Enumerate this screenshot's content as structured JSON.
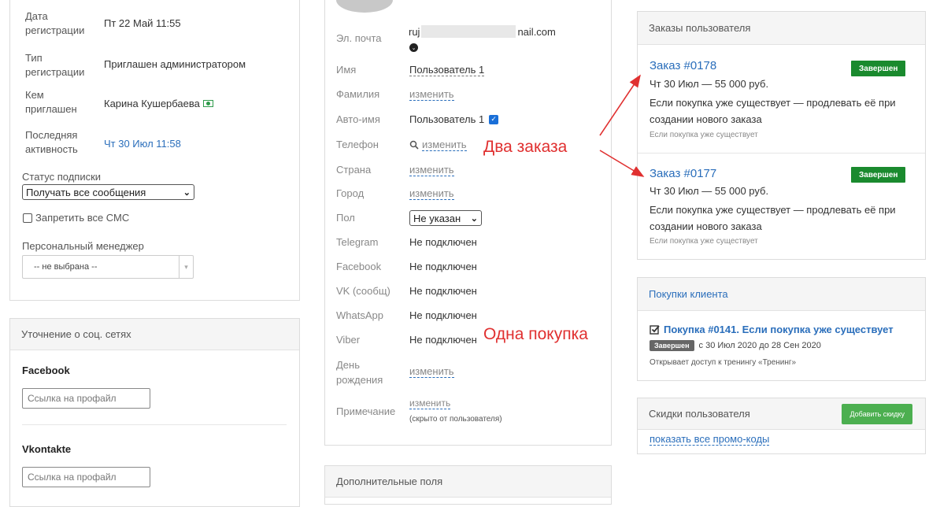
{
  "left": {
    "reg_date_label": "Дата регистрации",
    "reg_date_value": "Пт 22 Май 11:55",
    "reg_type_label": "Тип регистрации",
    "reg_type_value": "Приглашен администратором",
    "invited_by_label": "Кем приглашен",
    "invited_by_value": "Карина Кушербаева",
    "last_activity_label": "Последняя активность",
    "last_activity_value": "Чт 30 Июл 11:58",
    "subscription_label": "Статус подписки",
    "subscription_value": "Получать все сообщения",
    "block_sms_label": "Запретить все СМС",
    "manager_label": "Персональный менеджер",
    "manager_value": "-- не выбрана --"
  },
  "social": {
    "header": "Уточнение о соц. сетях",
    "facebook_title": "Facebook",
    "facebook_placeholder": "Ссылка на профайл",
    "vk_title": "Vkontakte",
    "vk_placeholder": "Ссылка на профайл"
  },
  "profile": {
    "email_label": "Эл. почта",
    "email_start": "ruj",
    "email_end": "nail.com",
    "name_label": "Имя",
    "name_value": "Пользователь 1",
    "surname_label": "Фамилия",
    "change": "изменить",
    "autoname_label": "Авто-имя",
    "autoname_value": "Пользователь 1",
    "phone_label": "Телефон",
    "country_label": "Страна",
    "city_label": "Город",
    "gender_label": "Пол",
    "gender_value": "Не указан",
    "telegram_label": "Telegram",
    "facebook_label": "Facebook",
    "vk_label": "VK (сообщ)",
    "whatsapp_label": "WhatsApp",
    "viber_label": "Viber",
    "not_connected": "Не подключен",
    "birthday_label": "День рождения",
    "note_label": "Примечание",
    "note_hidden": "(скрыто от пользователя)"
  },
  "extra": {
    "header": "Дополнительные поля"
  },
  "orders": {
    "header": "Заказы пользователя",
    "items": [
      {
        "title": "Заказ #0178",
        "status": "Завершен",
        "meta": "Чт 30 Июл — 55 000 руб.",
        "desc": "Если покупка уже существует — продлевать её при создании нового заказа",
        "small": "Если покупка уже существует"
      },
      {
        "title": "Заказ #0177",
        "status": "Завершен",
        "meta": "Чт 30 Июл — 55 000 руб.",
        "desc": "Если покупка уже существует — продлевать её при создании нового заказа",
        "small": "Если покупка уже существует"
      }
    ]
  },
  "purchases": {
    "header": "Покупки клиента",
    "title": "Покупка #0141. Если покупка уже существует",
    "status": "Завершен",
    "dates": "с 30 Июл 2020 до 28 Сен 2020",
    "access": "Открывает доступ к тренингу «Тренинг»"
  },
  "discounts": {
    "header": "Скидки пользователя",
    "add_button": "Добавить скидку",
    "show_promo": "показать все промо-коды"
  },
  "annotations": {
    "two_orders": "Два заказа",
    "one_purchase": "Одна покупка"
  },
  "colors": {
    "link": "#2a6ebb",
    "success": "#1a8a2e",
    "add_button": "#4caf50",
    "annotation": "#e03030"
  }
}
